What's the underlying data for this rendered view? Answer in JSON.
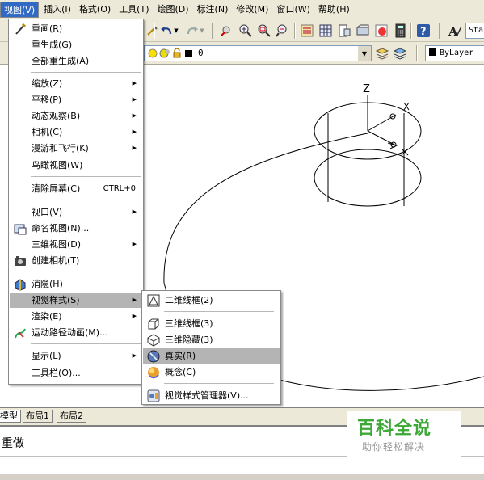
{
  "menubar": {
    "items": [
      {
        "label": "视图(V)",
        "active": true
      },
      {
        "label": "插入(I)"
      },
      {
        "label": "格式(O)"
      },
      {
        "label": "工具(T)"
      },
      {
        "label": "绘图(D)"
      },
      {
        "label": "标注(N)"
      },
      {
        "label": "修改(M)"
      },
      {
        "label": "窗口(W)"
      },
      {
        "label": "帮助(H)"
      }
    ]
  },
  "toolbar": {
    "layer_value": "0",
    "style_value": "Sta",
    "linetype_value": "ByLayer"
  },
  "view_menu": {
    "items": [
      {
        "label": "重画(R)",
        "icon": "pen-icon"
      },
      {
        "label": "重生成(G)"
      },
      {
        "label": "全部重生成(A)"
      },
      {
        "label": "缩放(Z)",
        "submenu": true
      },
      {
        "label": "平移(P)",
        "submenu": true
      },
      {
        "label": "动态观察(B)",
        "submenu": true
      },
      {
        "label": "相机(C)",
        "submenu": true
      },
      {
        "label": "漫游和飞行(K)",
        "submenu": true
      },
      {
        "label": "鸟瞰视图(W)"
      },
      {
        "label": "清除屏幕(C)",
        "shortcut": "CTRL+0"
      },
      {
        "label": "视口(V)",
        "submenu": true
      },
      {
        "label": "命名视图(N)...",
        "icon": "named-view-icon"
      },
      {
        "label": "三维视图(D)",
        "submenu": true
      },
      {
        "label": "创建相机(T)",
        "icon": "camera-icon"
      },
      {
        "label": "消隐(H)",
        "icon": "hide-icon"
      },
      {
        "label": "视觉样式(S)",
        "submenu": true,
        "highlighted": true
      },
      {
        "label": "渲染(E)",
        "submenu": true
      },
      {
        "label": "运动路径动画(M)...",
        "icon": "motion-path-icon"
      },
      {
        "label": "显示(L)",
        "submenu": true
      },
      {
        "label": "工具栏(O)..."
      }
    ]
  },
  "visual_styles_menu": {
    "items": [
      {
        "label": "二维线框(2)",
        "icon": "2d-wireframe-icon"
      },
      {
        "label": "三维线框(3)",
        "icon": "3d-wireframe-icon"
      },
      {
        "label": "三维隐藏(3)",
        "icon": "3d-hidden-icon"
      },
      {
        "label": "真实(R)",
        "icon": "realistic-icon",
        "highlighted": true
      },
      {
        "label": "概念(C)",
        "icon": "conceptual-icon"
      },
      {
        "label": "视觉样式管理器(V)...",
        "icon": "visual-styles-manager-icon"
      }
    ]
  },
  "drawing": {
    "axis_label": "Z"
  },
  "layout_tabs": [
    "模型",
    "布局1",
    "布局2"
  ],
  "command_line": {
    "text": "重做"
  },
  "watermark": {
    "title": "百科全说",
    "subtitle": "助你轻松解决"
  },
  "colors": {
    "menu_highlight": "#b4b4b4",
    "menubar_active": "#316ac5",
    "watermark_green": "#3ca836"
  }
}
